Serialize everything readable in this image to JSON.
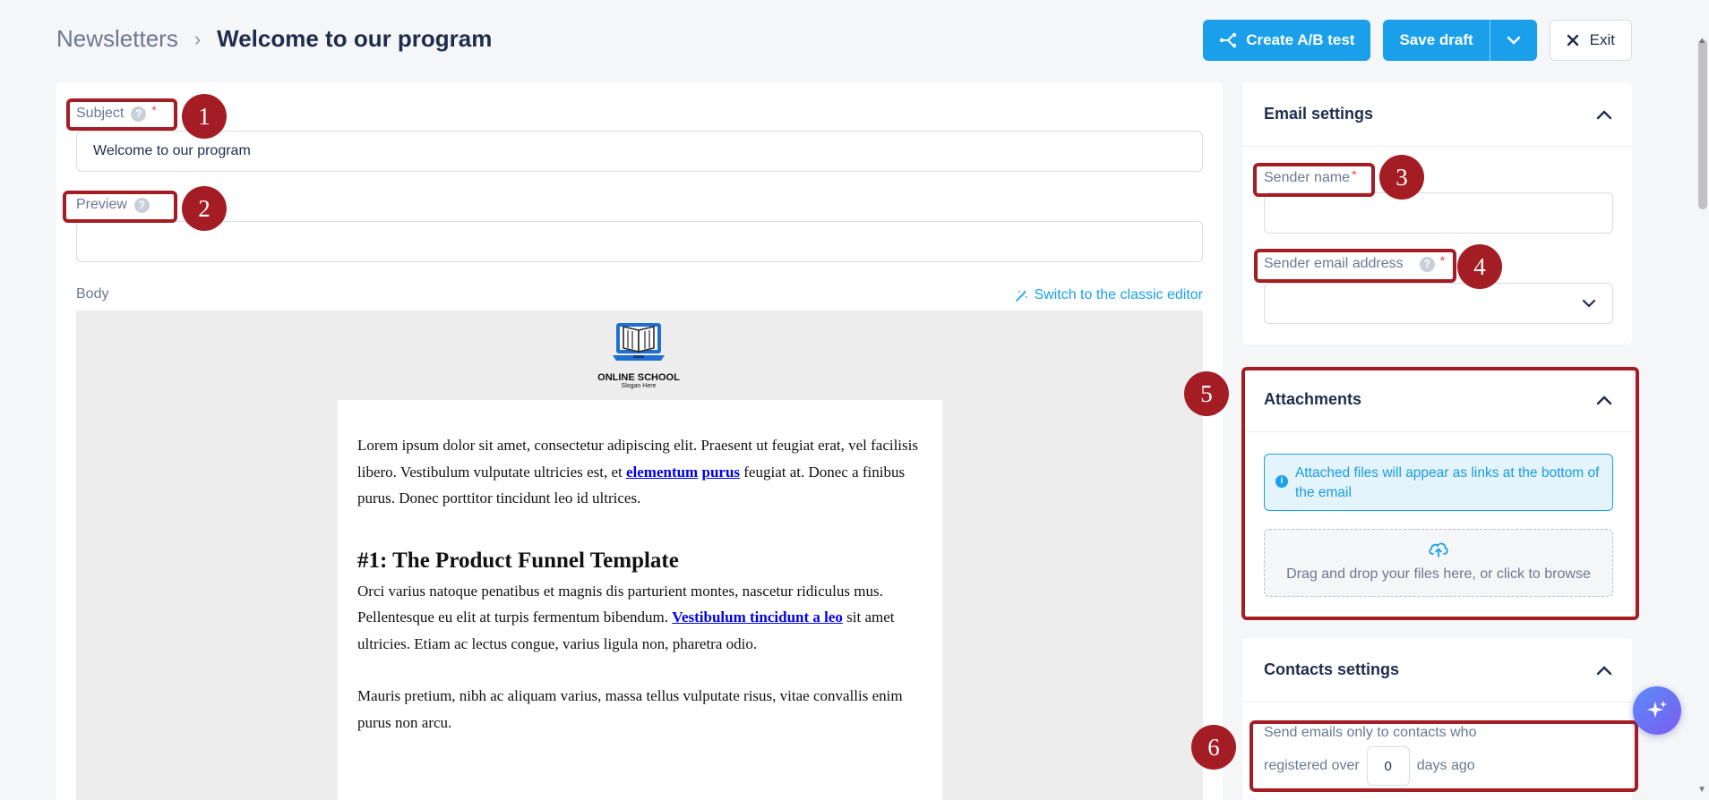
{
  "header": {
    "breadcrumb_parent": "Newsletters",
    "breadcrumb_separator": "›",
    "title": "Welcome to our program",
    "ab_test_label": "Create A/B test",
    "save_label": "Save draft",
    "exit_label": "Exit"
  },
  "form": {
    "subject_label": "Subject",
    "subject_value": "Welcome to our program",
    "preview_label": "Preview",
    "preview_value": "",
    "body_label": "Body",
    "switch_editor_label": "Switch to the classic editor",
    "required_mark": "*",
    "help_mark": "?"
  },
  "email": {
    "logo_name": "ONLINE SCHOOL",
    "logo_slogan": "Slogan Here",
    "p1_before": "Lorem ipsum dolor sit amet, consectetur adipiscing elit. Praesent ut feugiat erat, vel facilisis libero. Vestibulum vulputate ultricies est, et ",
    "p1_link1": "elementum",
    "p1_link2": "purus",
    "p1_after": " feugiat at. Donec a finibus purus. Donec porttitor tincidunt leo id ultrices.",
    "heading": "#1: The Product Funnel Template",
    "p2_before": "Orci varius natoque penatibus et magnis dis parturient montes, nascetur ridiculus mus. Pellentesque eu elit at turpis fermentum bibendum. ",
    "p2_link": "Vestibulum tincidunt a leo",
    "p2_after": " sit amet ultricies. Etiam ac lectus congue, varius ligula non, pharetra odio.",
    "p3": "Mauris pretium, nibh ac aliquam varius, massa tellus vulputate risus, vitae convallis enim purus non arcu."
  },
  "email_settings": {
    "title": "Email settings",
    "sender_name_label": "Sender name",
    "sender_name_value": "",
    "sender_email_label": "Sender email address",
    "sender_email_value": ""
  },
  "attachments": {
    "title": "Attachments",
    "info": "Attached files will appear as links at the bottom of the email",
    "dropzone": "Drag and drop your files here, or click to browse"
  },
  "contacts_settings": {
    "title": "Contacts settings",
    "rule_prefix": "Send emails only to contacts who",
    "rule_registered": "registered over",
    "days_value": "0",
    "rule_suffix": "days ago"
  },
  "annotations": [
    "1",
    "2",
    "3",
    "4",
    "5",
    "6"
  ],
  "colors": {
    "accent": "#1aa0eb",
    "annotation": "#a51d24",
    "title_text": "#1f2d4d"
  }
}
